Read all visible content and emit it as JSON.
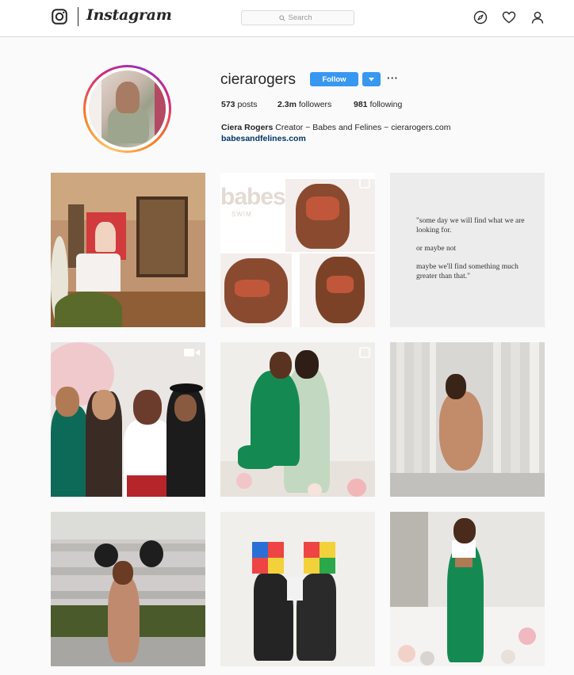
{
  "nav": {
    "wordmark": "Instagram",
    "search_placeholder": "Search",
    "icons": [
      "instagram-glyph-icon",
      "search-icon",
      "compass-icon",
      "heart-icon",
      "profile-icon"
    ]
  },
  "profile": {
    "username": "cierarogers",
    "follow_label": "Follow",
    "options_label": "···",
    "stats": [
      {
        "value": "573",
        "label": "posts"
      },
      {
        "value": "2.3m",
        "label": "followers"
      },
      {
        "value": "981",
        "label": "following"
      }
    ],
    "bio_name": "Ciera Rogers",
    "bio_text": "Creator ~ Babes and Felines ~ cierarogers.com",
    "bio_link": "babesandfelines.com"
  },
  "brand_overlay": {
    "main": "babes.",
    "sub": "SWIM"
  },
  "quote_post": {
    "lines": [
      "\"some day we will find what we are looking for.",
      "or maybe not",
      "maybe we'll find something much greater than that.\""
    ]
  },
  "posts": [
    {
      "name": "living-room-photo",
      "type": "photo"
    },
    {
      "name": "swimwear-collage-photo",
      "type": "carousel"
    },
    {
      "name": "quote-photo",
      "type": "photo"
    },
    {
      "name": "group-photo",
      "type": "video"
    },
    {
      "name": "hug-photo",
      "type": "carousel"
    },
    {
      "name": "lamp-posts-photo",
      "type": "photo"
    },
    {
      "name": "stairs-photo",
      "type": "photo"
    },
    {
      "name": "rubiks-mural-photo",
      "type": "photo"
    },
    {
      "name": "green-suit-photo",
      "type": "photo"
    }
  ],
  "colors": {
    "accent": "#3897f0",
    "link": "#003569",
    "text": "#262626",
    "border": "#dbdbdb"
  }
}
